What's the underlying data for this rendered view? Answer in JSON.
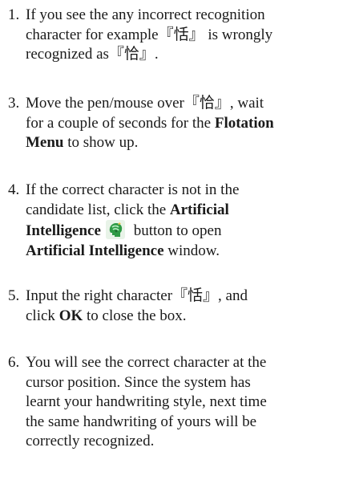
{
  "steps": [
    {
      "number": "1.",
      "lines": [
        "If you see the any incorrect recognition",
        "character for example『恬』 is wrongly",
        "recognized as『恰』."
      ]
    },
    {
      "number": "3.",
      "line1": "Move the pen/mouse over『恰』, wait",
      "line2_pre": "for a couple of seconds for the ",
      "line2_bold": "Flotation",
      "line3_bold": "Menu",
      "line3_post": " to show up."
    },
    {
      "number": "4.",
      "line1": "If the correct character is not in the",
      "line2_pre": "candidate list, click the ",
      "line2_bold": "Artificial",
      "line3_bold": "Intelligence",
      "line3_post": " button to open",
      "line4_bold": "Artificial Intelligence",
      "line4_post": " window.",
      "icon": "artificial-intelligence-icon"
    },
    {
      "number": "5.",
      "line1": "Input the right character『恬』, and",
      "line2_pre": "click ",
      "line2_bold": "OK",
      "line2_post": " to close the box."
    },
    {
      "number": "6.",
      "lines": [
        "You will see the correct character at the",
        "cursor position. Since the system has",
        "learnt your handwriting style, next time",
        "the same handwriting of yours will be",
        "correctly recognized."
      ]
    }
  ]
}
